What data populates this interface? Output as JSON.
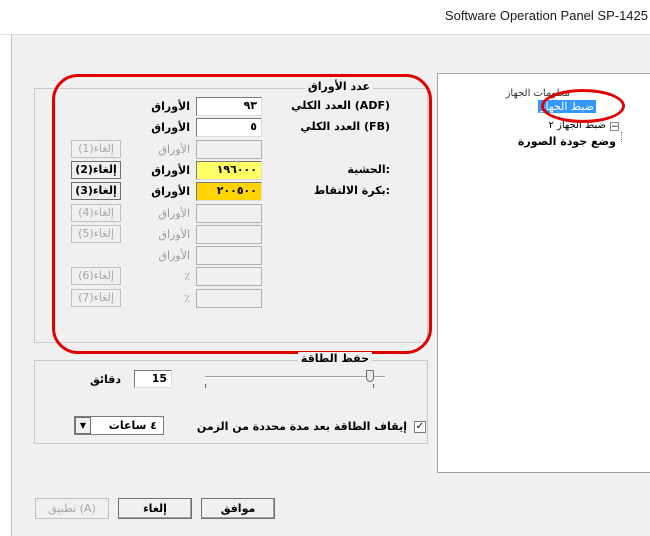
{
  "window": {
    "title": "Software Operation Panel SP-1425"
  },
  "tree": {
    "item1": "معلومات الجهاز",
    "item2_selected": "ضبط الجهاز",
    "item3": "ضبط الجهاز ٢",
    "item4": "وضع جودة الصورة"
  },
  "counter_group": {
    "title": "عدد الأوراق",
    "rows": [
      {
        "label": "العدد الكلي (ADF)",
        "value": "٩٣",
        "unit": "الأوراق"
      },
      {
        "label": "العدد الكلي (FB)",
        "value": "٥",
        "unit": "الأوراق"
      },
      {
        "label": "",
        "value": "",
        "unit": "الأوراق",
        "button": "إلغاء(1)"
      },
      {
        "label": "الحشية:",
        "value": "١٩٦٠٠٠",
        "unit": "الأوراق",
        "button": "إلغاء(2)"
      },
      {
        "label": "بكرة الالتقاط:",
        "value": "٢٠٠٥٠٠",
        "unit": "الأوراق",
        "button": "إلغاء(3)"
      },
      {
        "label": "",
        "value": "",
        "unit": "الأوراق",
        "button": "إلغاء(4)"
      },
      {
        "label": "",
        "value": "",
        "unit": "الأوراق",
        "button": "إلغاء(5)"
      },
      {
        "label": "",
        "value": "",
        "unit": "الأوراق"
      },
      {
        "label": "",
        "value": "",
        "unit": "٪",
        "button": "إلغاء(6)"
      },
      {
        "label": "",
        "value": "",
        "unit": "٪",
        "button": "إلغاء(7)"
      }
    ],
    "colors": {
      "pad_highlight": "#ffff66",
      "roller_highlight": "#ffd400",
      "annotation": "#e00000"
    }
  },
  "power_group": {
    "title": "حفظ الطاقة",
    "minutes_value": "15",
    "minutes_label": "دقائق",
    "auto_off_checked": true,
    "auto_off_label": "إيقاف الطاقة بعد مدة محددة من الزمن",
    "hours_selected": "٤ ساعات"
  },
  "buttons": {
    "ok": "موافق",
    "cancel": "إلغاء",
    "apply": "تطبيق (A)"
  }
}
